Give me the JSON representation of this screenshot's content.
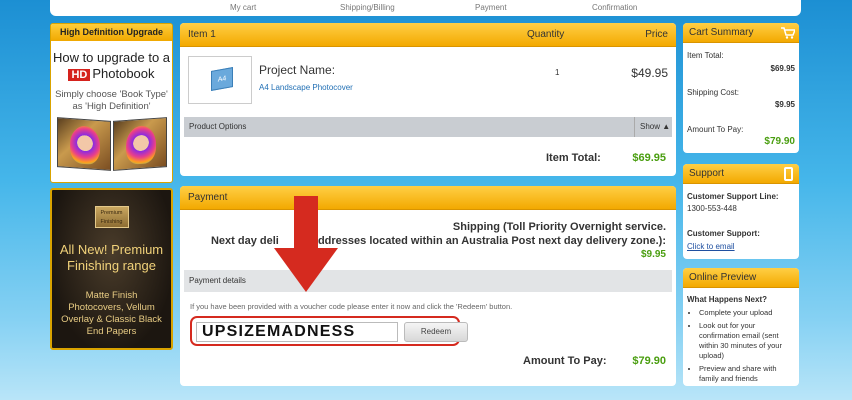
{
  "steps": [
    "My cart",
    "Shipping/Billing",
    "Payment",
    "Confirmation"
  ],
  "hd_promo": {
    "header": "High Definition Upgrade",
    "title_line1": "How to upgrade to a",
    "badge": "HD",
    "title_line2": "Photobook",
    "subtitle": "Simply choose 'Book Type' as 'High Definition'"
  },
  "premium_promo": {
    "box_text": "Premium Finishing",
    "title": "All New! Premium Finishing range",
    "description": "Matte Finish Photocovers, Vellum Overlay & Classic Black End Papers"
  },
  "item_panel": {
    "header": "Item 1",
    "quantity_header": "Quantity",
    "price_header": "Price",
    "thumb_label": "A4",
    "project_name": "Project Name:",
    "project_sub": "A4 Landscape Photocover",
    "quantity": "1",
    "price": "$49.95",
    "options_label": "Product Options",
    "show_label": "Show",
    "item_total_label": "Item Total:",
    "item_total_value": "$69.95"
  },
  "payment_panel": {
    "header": "Payment",
    "shipping_line1": "Shipping (Toll Priority Overnight service.",
    "shipping_line2": "Next day deli     for addresses located within an Australia Post next day delivery zone.):",
    "shipping_fee": "$9.95",
    "details_label": "Payment details",
    "voucher_text": "If you have been provided with a voucher code please enter it now and click the 'Redeem' button.",
    "voucher_value": "UPSIZEMADNESS",
    "redeem_label": "Redeem",
    "amount_label": "Amount To Pay:",
    "amount_value": "$79.90"
  },
  "cart_summary": {
    "header": "Cart Summary",
    "item_total_label": "Item Total:",
    "item_total_value": "$69.95",
    "shipping_label": "Shipping Cost:",
    "shipping_value": "$9.95",
    "amount_label": "Amount To Pay:",
    "amount_value": "$79.90"
  },
  "support": {
    "header": "Support",
    "line_label": "Customer Support Line:",
    "line_value": "1300-553-448",
    "support_label": "Customer Support:",
    "email_link": "Click to email"
  },
  "online_preview": {
    "header": "Online Preview",
    "question": "What Happens Next?",
    "steps": [
      "Complete your upload",
      "Look out for your confirmation email (sent within 30 minutes of your upload)",
      "Preview and share with family and friends"
    ]
  },
  "colors": {
    "accent_orange": "#f3a900",
    "price_green": "#4a9e10",
    "highlight_red": "#d52a1f"
  }
}
